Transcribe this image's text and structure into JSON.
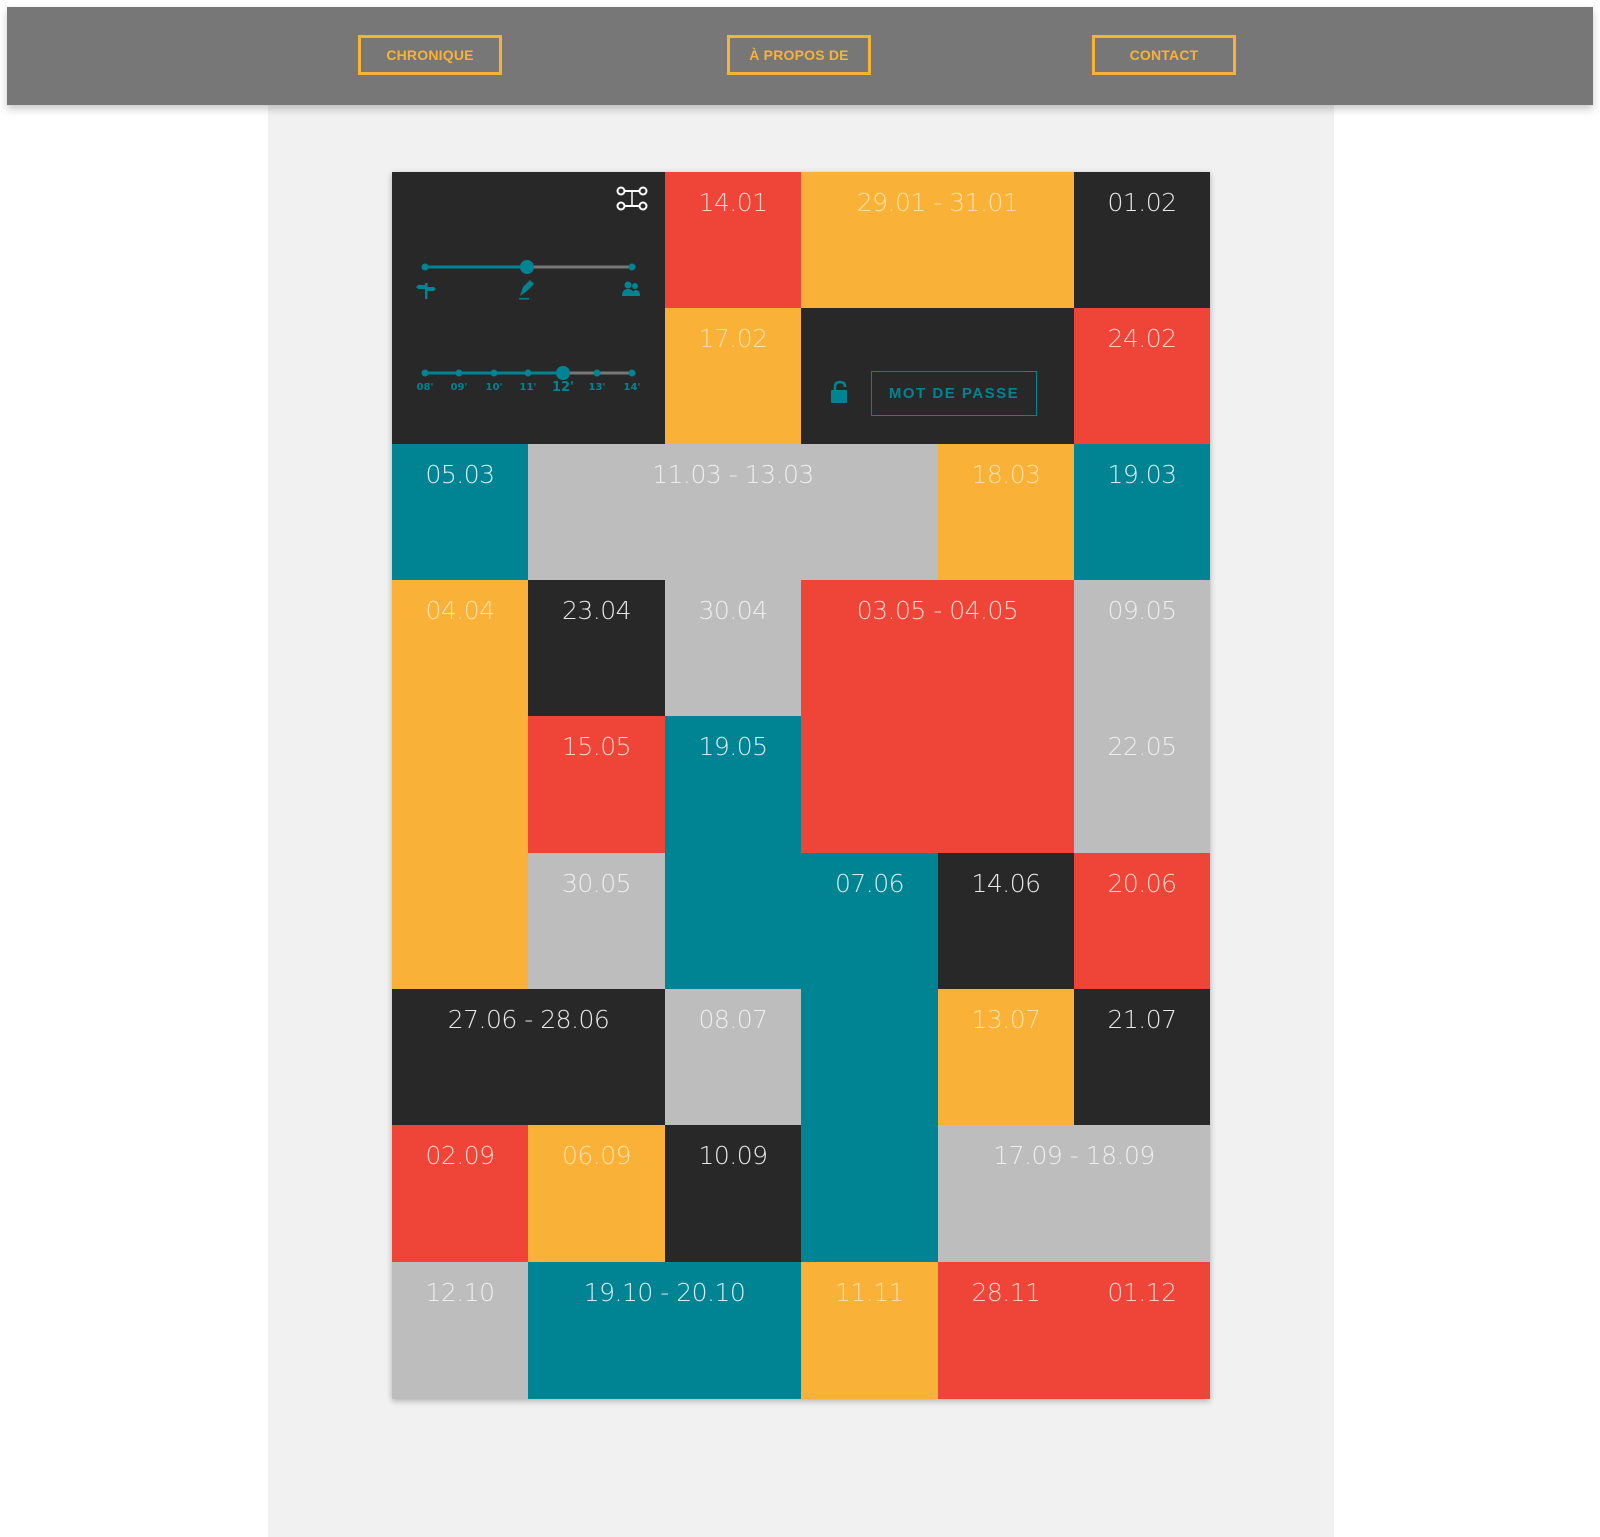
{
  "nav": {
    "chronique": "CHRONIQUE",
    "apropos": "À PROPOS DE",
    "contact": "CONTACT"
  },
  "controls": {
    "mode_slider_value": 0.5,
    "mode_icons": [
      "signpost-icon",
      "pencil-icon",
      "users-icon"
    ],
    "hour_ticks": [
      "08'",
      "09'",
      "10'",
      "11'",
      "12'",
      "13'",
      "14'"
    ],
    "selected_hour": "12'",
    "password_button": "MOT DE PASSE"
  },
  "colors": {
    "red": "#ef4538",
    "yellow": "#f9b237",
    "black": "#282828",
    "teal": "#008493",
    "gray": "#bdbdbd",
    "nav": "#777777"
  },
  "dates": [
    {
      "label": "14.01",
      "color": "red"
    },
    {
      "label": "29.01 - 31.01",
      "color": "yellow"
    },
    {
      "label": "01.02",
      "color": "black"
    },
    {
      "label": "17.02",
      "color": "yellow"
    },
    {
      "label": "24.02",
      "color": "red"
    },
    {
      "label": "05.03",
      "color": "teal"
    },
    {
      "label": "11.03 - 13.03",
      "color": "gray"
    },
    {
      "label": "18.03",
      "color": "yellow"
    },
    {
      "label": "19.03",
      "color": "teal"
    },
    {
      "label": "04.04",
      "color": "yellow"
    },
    {
      "label": "23.04",
      "color": "black"
    },
    {
      "label": "30.04",
      "color": "gray"
    },
    {
      "label": "03.05 - 04.05",
      "color": "red"
    },
    {
      "label": "09.05",
      "color": "gray"
    },
    {
      "label": "15.05",
      "color": "red"
    },
    {
      "label": "19.05",
      "color": "teal"
    },
    {
      "label": "22.05",
      "color": "gray"
    },
    {
      "label": "30.05",
      "color": "gray"
    },
    {
      "label": "07.06",
      "color": "teal"
    },
    {
      "label": "14.06",
      "color": "black"
    },
    {
      "label": "20.06",
      "color": "red"
    },
    {
      "label": "27.06 - 28.06",
      "color": "black"
    },
    {
      "label": "08.07",
      "color": "gray"
    },
    {
      "label": "13.07",
      "color": "yellow"
    },
    {
      "label": "21.07",
      "color": "black"
    },
    {
      "label": "02.09",
      "color": "red"
    },
    {
      "label": "06.09",
      "color": "yellow"
    },
    {
      "label": "10.09",
      "color": "black"
    },
    {
      "label": "17.09 - 18.09",
      "color": "gray"
    },
    {
      "label": "12.10",
      "color": "gray"
    },
    {
      "label": "19.10 - 20.10",
      "color": "teal"
    },
    {
      "label": "11.11",
      "color": "yellow"
    },
    {
      "label": "28.11",
      "color": "red"
    },
    {
      "label": "01.12",
      "color": "red"
    }
  ]
}
